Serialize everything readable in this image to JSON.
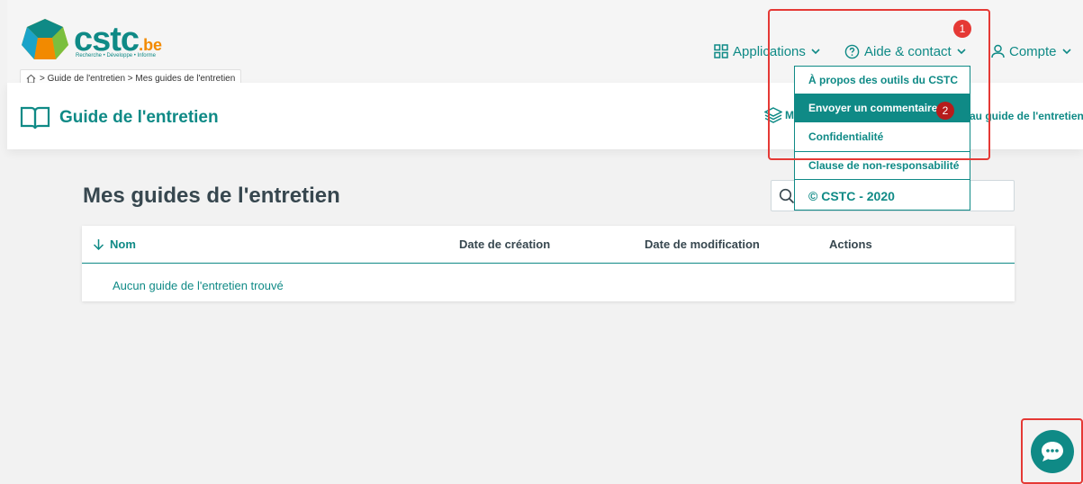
{
  "header": {
    "logo": {
      "name": "cstc",
      "suffix": ".be",
      "tagline": "Recherche • Développe • Informe"
    },
    "nav": [
      {
        "label": "Applications",
        "icon": "grid-icon"
      },
      {
        "label": "Aide & contact",
        "icon": "help-circle-icon"
      },
      {
        "label": "Compte",
        "icon": "user-icon"
      }
    ]
  },
  "breadcrumb": {
    "text": "> Guide de l'entretien > Mes guides de l'entretien"
  },
  "subheader": {
    "title": "Guide de l'entretien",
    "left_fragment": "M",
    "right_link": "au guide de l'entretien"
  },
  "page": {
    "heading": "Mes guides de l'entretien",
    "search_placeholder": ""
  },
  "table": {
    "columns": [
      "Nom",
      "Date de création",
      "Date de modification",
      "Actions"
    ],
    "empty_message": "Aucun guide de l'entretien trouvé"
  },
  "dropdown": {
    "items": [
      "À propos des outils du CSTC",
      "Envoyer un commentaire",
      "Confidentialité",
      "Clause de non-responsabilité",
      "© CSTC - 2020"
    ],
    "active_index": 1
  },
  "annotations": {
    "badge_1": "1",
    "badge_2": "2"
  },
  "colors": {
    "accent": "#0f8a86",
    "orange": "#f28a00",
    "highlight": "#e53935"
  }
}
